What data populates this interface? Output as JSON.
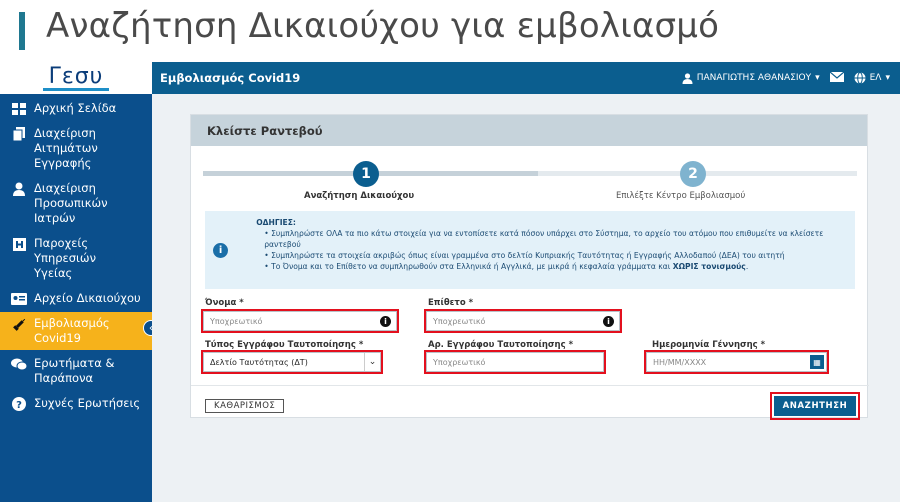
{
  "slide": {
    "title": "Αναζήτηση Δικαιούχου για εμβολιασμό"
  },
  "logo": {
    "text": "Γεσυ"
  },
  "topbar": {
    "app_title": "Εμβολιασμός Covid19",
    "user_name": "ΠΑΝΑΓΙΩΤΗΣ ΑΘΑΝΑΣΙΟΥ",
    "language": "ΕΛ"
  },
  "sidebar": {
    "items": [
      {
        "label": "Αρχική Σελίδα",
        "icon": "grid-icon",
        "active": false
      },
      {
        "label": "Διαχείριση Αιτημάτων Εγγραφής",
        "icon": "documents-icon",
        "active": false
      },
      {
        "label": "Διαχείριση Προσωπικών Ιατρών",
        "icon": "doctor-icon",
        "active": false
      },
      {
        "label": "Παροχείς Υπηρεσιών Υγείας",
        "icon": "hospital-icon",
        "active": false
      },
      {
        "label": "Αρχείο Δικαιούχου",
        "icon": "id-card-icon",
        "active": false
      },
      {
        "label": "Εμβολιασμός Covid19",
        "icon": "syringe-icon",
        "active": true
      },
      {
        "label": "Ερωτήματα & Παράπονα",
        "icon": "chat-icon",
        "active": false
      },
      {
        "label": "Συχνές Ερωτήσεις",
        "icon": "question-icon",
        "active": false
      }
    ]
  },
  "card": {
    "title": "Κλείστε Ραντεβού"
  },
  "stepper": {
    "steps": [
      {
        "number": "1",
        "label": "Αναζήτηση Δικαιούχου",
        "state": "current"
      },
      {
        "number": "2",
        "label": "Επιλέξτε Κέντρο Εμβολιασμού",
        "state": "pending"
      }
    ]
  },
  "info": {
    "heading": "ΟΔΗΓΙΕΣ:",
    "lines": [
      "Συμπληρώστε ΟΛΑ τα πιο κάτω στοιχεία για να εντοπίσετε κατά πόσον υπάρχει στο Σύστημα, το αρχείο του ατόμου που επιθυμείτε να κλείσετε ραντεβού",
      "Συμπληρώστε τα στοιχεία ακριβώς όπως είναι γραμμένα στο δελτίο Κυπριακής Ταυτότητας ή Εγγραφής Αλλοδαπού (ΔΕΑ) του αιτητή",
      "Το Όνομα και το Επίθετο να συμπληρωθούν στα Ελληνικά ή Αγγλικά, με μικρά ή κεφαλαία γράμματα και "
    ],
    "emphasis": "ΧΩΡΙΣ τονισμούς"
  },
  "form": {
    "first_name": {
      "label": "Όνομα *",
      "placeholder": "Υποχρεωτικό"
    },
    "last_name": {
      "label": "Επίθετο *",
      "placeholder": "Υποχρεωτικό"
    },
    "id_type": {
      "label": "Τύπος Εγγράφου Ταυτοποίησης *",
      "value": "Δελτίο Ταυτότητας (ΔΤ)"
    },
    "id_number": {
      "label": "Αρ. Εγγράφου Ταυτοποίησης *",
      "placeholder": "Υποχρεωτικό"
    },
    "birth_date": {
      "label": "Ημερομηνία Γέννησης *",
      "placeholder": "ΗΗ/ΜΜ/ΧΧΧΧ"
    }
  },
  "buttons": {
    "clear": "ΚΑΘΑΡΙΣΜΟΣ",
    "search": "ΑΝΑΖΗΤΗΣΗ"
  },
  "colors": {
    "primary": "#0b5e8f",
    "sidebar": "#0b4f8c",
    "active": "#f6b21b",
    "highlight": "#e3101e"
  }
}
